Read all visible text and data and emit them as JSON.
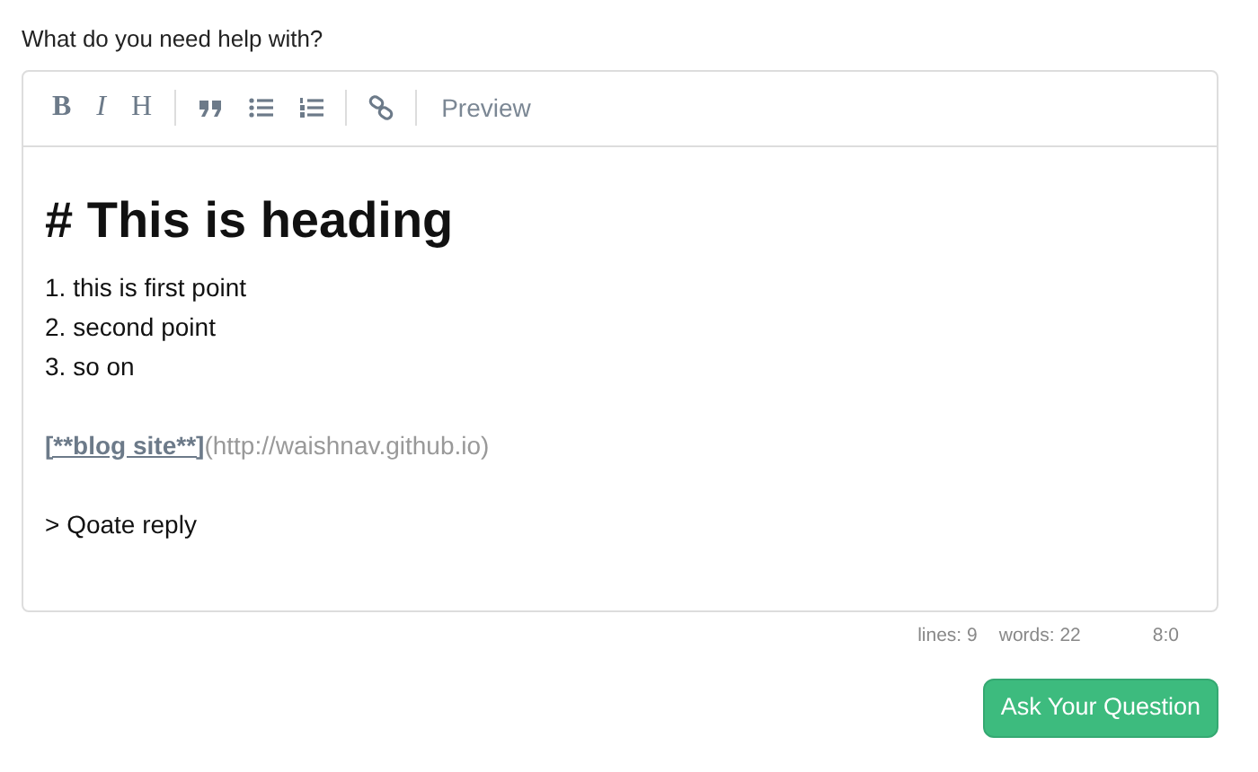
{
  "label": "What do you need help with?",
  "toolbar": [
    {
      "kind": "bold",
      "glyph": "B"
    },
    {
      "kind": "italic",
      "glyph": "I"
    },
    {
      "kind": "heading",
      "glyph": "H"
    },
    {
      "kind": "divider"
    },
    {
      "kind": "quote"
    },
    {
      "kind": "bullets"
    },
    {
      "kind": "numbers"
    },
    {
      "kind": "divider"
    },
    {
      "kind": "link"
    },
    {
      "kind": "divider"
    },
    {
      "kind": "preview",
      "label": "Preview"
    }
  ],
  "editor_lines": [
    {
      "kind": "heading",
      "text": "# This is heading"
    },
    {
      "kind": "text",
      "text": "1. this is first point"
    },
    {
      "kind": "text",
      "text": "2. second point"
    },
    {
      "kind": "text",
      "text": "3. so on"
    },
    {
      "kind": "blank"
    },
    {
      "kind": "link",
      "label": "[**blog site**]",
      "url": "(http://waishnav.github.io)"
    },
    {
      "kind": "blank"
    },
    {
      "kind": "text",
      "text": "> Qoate reply"
    }
  ],
  "status_bar": {
    "lines": "lines: 9",
    "words": "words: 22",
    "cursor": "8:0"
  },
  "submit_button": "Ask Your Question"
}
